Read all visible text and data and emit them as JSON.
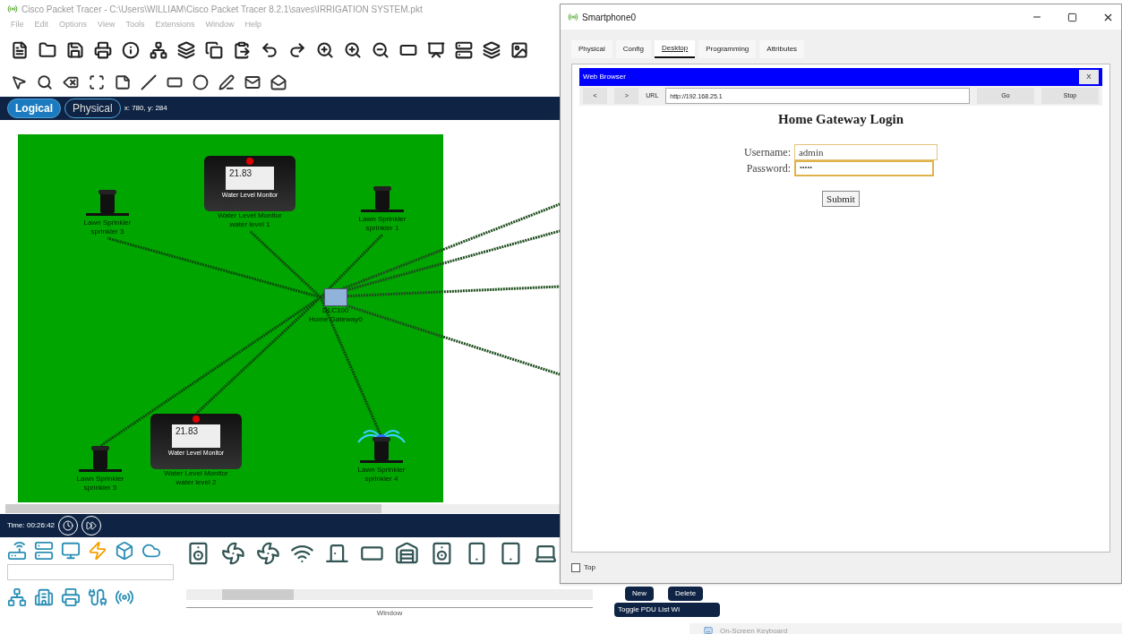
{
  "app_title": "Cisco Packet Tracer - C:\\Users\\WILLIAM\\Cisco Packet Tracer 8.2.1\\saves\\IRRIGATION SYSTEM.pkt",
  "menu": [
    "File",
    "Edit",
    "Options",
    "View",
    "Tools",
    "Extensions",
    "Window",
    "Help"
  ],
  "view_tabs": [
    {
      "label": "Logical",
      "selected": true
    },
    {
      "label": "Physical",
      "selected": false
    }
  ],
  "coordinates": "x: 780, y: 284",
  "topology": {
    "nodes": [
      {
        "kind": "sprinkler",
        "name": "Lawn Sprinkler",
        "label": "sprinkler 3",
        "on": false
      },
      {
        "kind": "monitor",
        "display": "21.83",
        "caption": "Water Level Monitor",
        "name": "Water Level Monitor",
        "label": "water level 1"
      },
      {
        "kind": "sprinkler",
        "name": "Lawn Sprinkler",
        "label": "sprinkler 1",
        "on": false
      },
      {
        "kind": "gateway",
        "name": "DLC100",
        "label": "Home Gateway0"
      },
      {
        "kind": "sprinkler",
        "name": "Lawn Sprinkler",
        "label": "sprinkler 5",
        "on": false
      },
      {
        "kind": "monitor",
        "display": "21.83",
        "caption": "Water Level Monitor",
        "name": "Water Level Monitor",
        "label": "water level 2"
      },
      {
        "kind": "sprinkler",
        "name": "Lawn Sprinkler",
        "label": "sprinkler 4",
        "on": true
      }
    ]
  },
  "time": "Time: 00:26:42",
  "device_panel": {
    "window_label": "Window"
  },
  "pdu_buttons": [
    "New",
    "Delete",
    "Toggle PDU List Wi"
  ],
  "keyboard_window": {
    "title": "On-Screen Keyboard"
  },
  "smartphone": {
    "title": "Smartphone0",
    "tabs": [
      {
        "label": "Physical",
        "selected": false
      },
      {
        "label": "Config",
        "selected": false
      },
      {
        "label": "Desktop",
        "selected": true
      },
      {
        "label": "Programming",
        "selected": false
      },
      {
        "label": "Attributes",
        "selected": false
      }
    ],
    "browser": {
      "title": "Web Browser",
      "close": "X",
      "back": "<",
      "forward": ">",
      "url_label": "URL",
      "url": "http://192.168.25.1",
      "go": "Go",
      "stop": "Stop",
      "heading": "Home Gateway Login",
      "username_label": "Username:",
      "username": "admin",
      "password_label": "Password:",
      "password": "•••••",
      "submit": "Submit"
    },
    "top": {
      "label": "Top",
      "checked": false
    }
  }
}
